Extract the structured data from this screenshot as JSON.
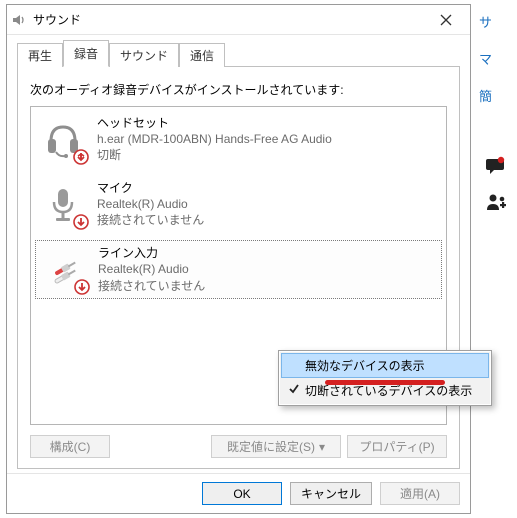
{
  "window": {
    "title": "サウンド"
  },
  "tabs": {
    "play": "再生",
    "record": "録音",
    "sound": "サウンド",
    "comm": "通信",
    "active": "record"
  },
  "instruction": "次のオーディオ録音デバイスがインストールされています:",
  "devices": [
    {
      "name": "ヘッドセット",
      "subtitle": "h.ear (MDR-100ABN) Hands-Free AG Audio",
      "status": "切断",
      "icon": "headset-icon",
      "badge": "down"
    },
    {
      "name": "マイク",
      "subtitle": "Realtek(R) Audio",
      "status": "接続されていません",
      "icon": "microphone-icon",
      "badge": "down"
    },
    {
      "name": "ライン入力",
      "subtitle": "Realtek(R) Audio",
      "status": "接続されていません",
      "icon": "linein-icon",
      "badge": "down",
      "selected": true
    }
  ],
  "buttons": {
    "configure": "構成(C)",
    "set_default": "既定値に設定(S)",
    "set_default_dd": "▾",
    "properties": "プロパティ(P)",
    "ok": "OK",
    "cancel": "キャンセル",
    "apply": "適用(A)"
  },
  "context_menu": {
    "show_disabled": "無効なデバイスの表示",
    "show_disconnected": "切断されているデバイスの表示"
  },
  "gutter": {
    "l1": "サ",
    "l2": "マ",
    "l3": "簡"
  }
}
